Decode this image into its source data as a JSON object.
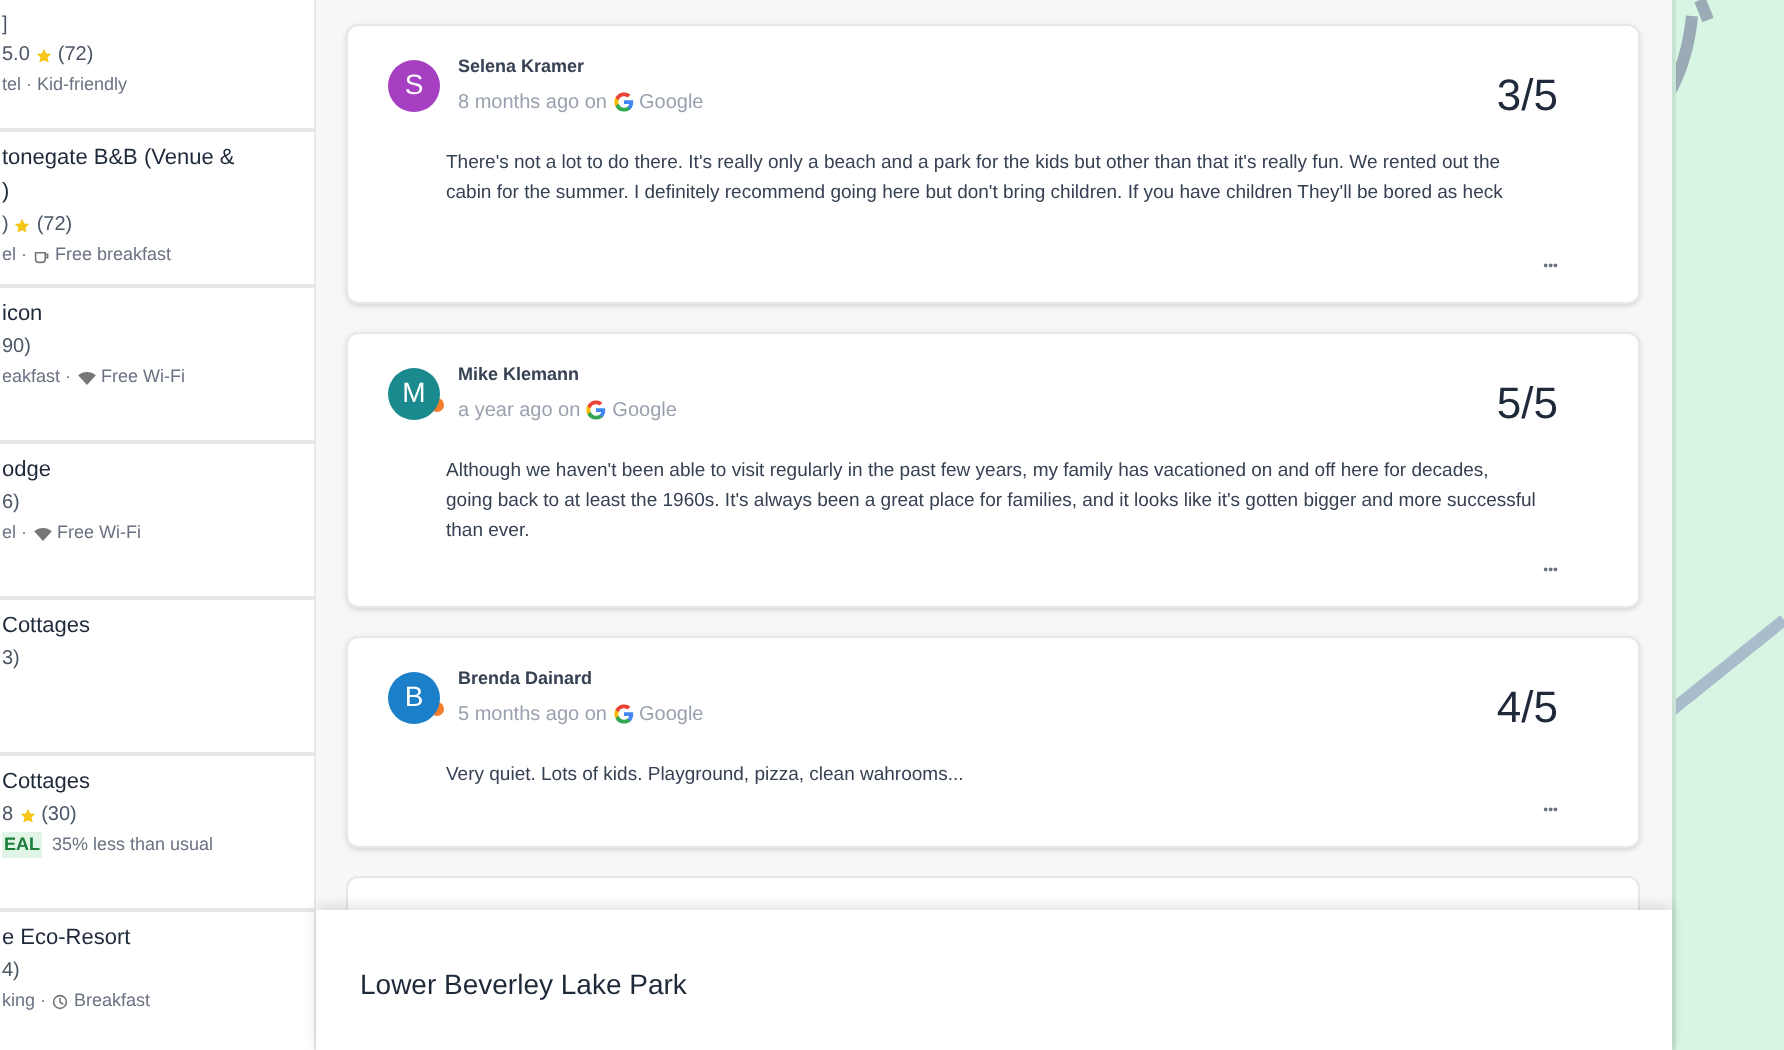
{
  "sidebar": {
    "items": [
      {
        "lines": [
          {
            "kind": "text",
            "text": "]"
          },
          {
            "kind": "rating",
            "value": "5.0",
            "count": "(72)"
          },
          {
            "kind": "plain_amenity",
            "text": "tel · Kid-friendly"
          }
        ]
      },
      {
        "lines": [
          {
            "kind": "title",
            "text": "tonegate B&B (Venue &"
          },
          {
            "kind": "title",
            "text": ")"
          },
          {
            "kind": "rating",
            "value": ")",
            "count": "(72)"
          },
          {
            "kind": "breakfast_amenity",
            "text": "el ·",
            "label": "Free breakfast"
          }
        ]
      },
      {
        "lines": [
          {
            "kind": "title",
            "text": "icon"
          },
          {
            "kind": "text",
            "text": "90)"
          },
          {
            "kind": "wifi_amenity",
            "text": "eakfast ·",
            "label": "Free Wi-Fi"
          }
        ]
      },
      {
        "lines": [
          {
            "kind": "title",
            "text": "odge"
          },
          {
            "kind": "text",
            "text": "6)"
          },
          {
            "kind": "wifi_amenity",
            "text": "el ·",
            "label": "Free Wi-Fi"
          }
        ]
      },
      {
        "lines": [
          {
            "kind": "title",
            "text": "Cottages"
          },
          {
            "kind": "text",
            "text": "3)"
          }
        ]
      },
      {
        "lines": [
          {
            "kind": "title",
            "text": "Cottages"
          },
          {
            "kind": "rating",
            "value": "8",
            "count": "(30)"
          },
          {
            "kind": "deal",
            "badge": "EAL",
            "text": "35% less than usual"
          }
        ]
      },
      {
        "lines": [
          {
            "kind": "title",
            "text": "e Eco-Resort"
          },
          {
            "kind": "text",
            "text": "4)"
          },
          {
            "kind": "clock_amenity",
            "text": "king ·",
            "label": "Breakfast"
          }
        ]
      }
    ]
  },
  "reviews": [
    {
      "initial": "S",
      "color": "#a63fc2",
      "local_guide": false,
      "name": "Selena Kramer",
      "time": "8 months ago on",
      "source": "Google",
      "score": "3/5",
      "text": "There's not a lot to do there. It's really only a beach and a park for the kids but other than that it's really fun. We rented out the cabin for the summer. I definitely recommend going here but don't bring children. If you have children They'll be bored as heck",
      "more": "•••"
    },
    {
      "initial": "M",
      "color": "#1a8a8f",
      "local_guide": true,
      "name": "Mike Klemann",
      "time": "a year ago on",
      "source": "Google",
      "score": "5/5",
      "text": "Although we haven't been able to visit regularly in the past few years, my family has vacationed on and off here for decades, going back to at least the 1960s. It's always been a great place for families, and it looks like it's gotten bigger and more successful than ever.",
      "more": "•••"
    },
    {
      "initial": "B",
      "color": "#1c7fc9",
      "local_guide": true,
      "name": "Brenda Dainard",
      "time": "5 months ago on",
      "source": "Google",
      "score": "4/5",
      "text": "Very quiet. Lots of kids. Playground, pizza, clean wahrooms...",
      "more": "•••"
    }
  ],
  "bottom_sheet": {
    "title": "Lower Beverley Lake Park"
  }
}
